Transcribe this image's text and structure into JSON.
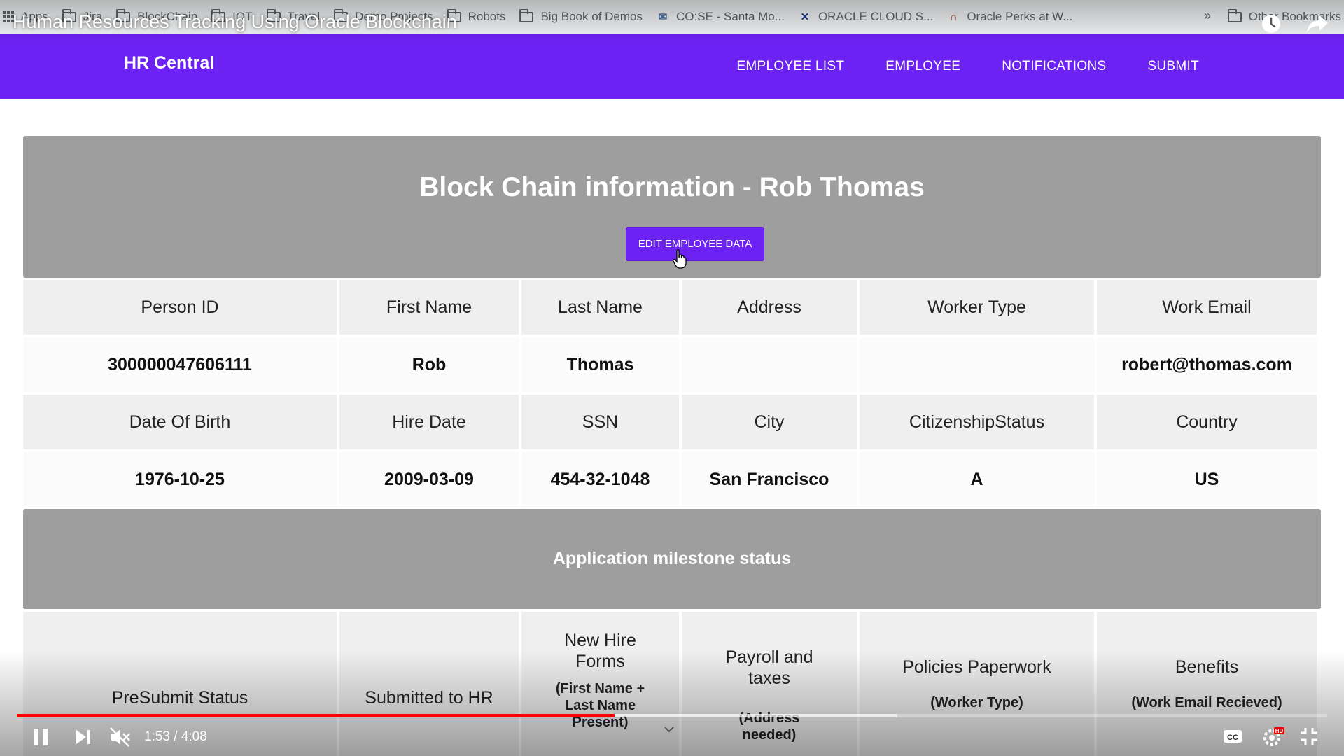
{
  "bookmarks": {
    "items": [
      "Apps",
      "Jira",
      "BlockChain",
      "IOT",
      "Travel",
      "Demo Projects",
      "Robots",
      "Big Book of Demos",
      "CO:SE - Santa Mo...",
      "ORACLE CLOUD S...",
      "Oracle Perks at W..."
    ],
    "more": "»",
    "other": "Other Bookmarks"
  },
  "video": {
    "title": "Human Resources Tracking Using Oracle Blockchain",
    "time_current": "1:53",
    "time_total": "4:08",
    "time_display": "1:53 / 4:08",
    "progress_fraction": 0.456,
    "buffer_fraction": 0.672
  },
  "nav": {
    "brand": "HR Central",
    "links": [
      "EMPLOYEE LIST",
      "EMPLOYEE",
      "NOTIFICATIONS",
      "SUBMIT"
    ]
  },
  "panel": {
    "title": "Block Chain information - Rob Thomas",
    "edit_button": "EDIT EMPLOYEE DATA"
  },
  "table1": {
    "headers": [
      "Person ID",
      "First Name",
      "Last Name",
      "Address",
      "Worker Type",
      "Work Email"
    ],
    "values": [
      "300000047606111",
      "Rob",
      "Thomas",
      "",
      "",
      "robert@thomas.com"
    ]
  },
  "table2": {
    "headers": [
      "Date Of Birth",
      "Hire Date",
      "SSN",
      "City",
      "CitizenshipStatus",
      "Country"
    ],
    "values": [
      "1976-10-25",
      "2009-03-09",
      "454-32-1048",
      "San Francisco",
      "A",
      "US"
    ]
  },
  "milestones": {
    "title": "Application milestone status",
    "columns": [
      {
        "label": "PreSubmit Status",
        "sub": ""
      },
      {
        "label": "Submitted to HR",
        "sub": ""
      },
      {
        "label": "New Hire Forms",
        "sub": "(First Name + Last Name Present)"
      },
      {
        "label": "Payroll and taxes",
        "sub": "(Address needed)"
      },
      {
        "label": "Policies Paperwork",
        "sub": "(Worker Type)"
      },
      {
        "label": "Benefits",
        "sub": "(Work Email Recieved)"
      }
    ]
  },
  "colors": {
    "brand_purple": "#6c22f2",
    "panel_grey": "#9e9e9e",
    "progress_red": "#ff0000"
  }
}
